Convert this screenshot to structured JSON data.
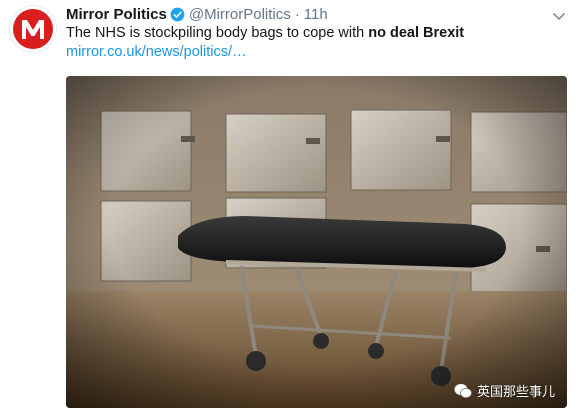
{
  "account": {
    "name": "Mirror Politics",
    "handle": "@MirrorPolitics",
    "separator": "·",
    "time": "11h",
    "avatar_letter": "M"
  },
  "tweet": {
    "text_before": "The NHS is stockpiling body bags to cope with ",
    "text_bold": "no deal Brexit",
    "link": "mirror.co.uk/news/politics/…"
  },
  "media": {
    "watermark": "英国那些事儿"
  },
  "colors": {
    "brand_red": "#d81e1e",
    "link_blue": "#1b95e0",
    "verified_blue": "#1da1f2",
    "muted_gray": "#657786"
  }
}
